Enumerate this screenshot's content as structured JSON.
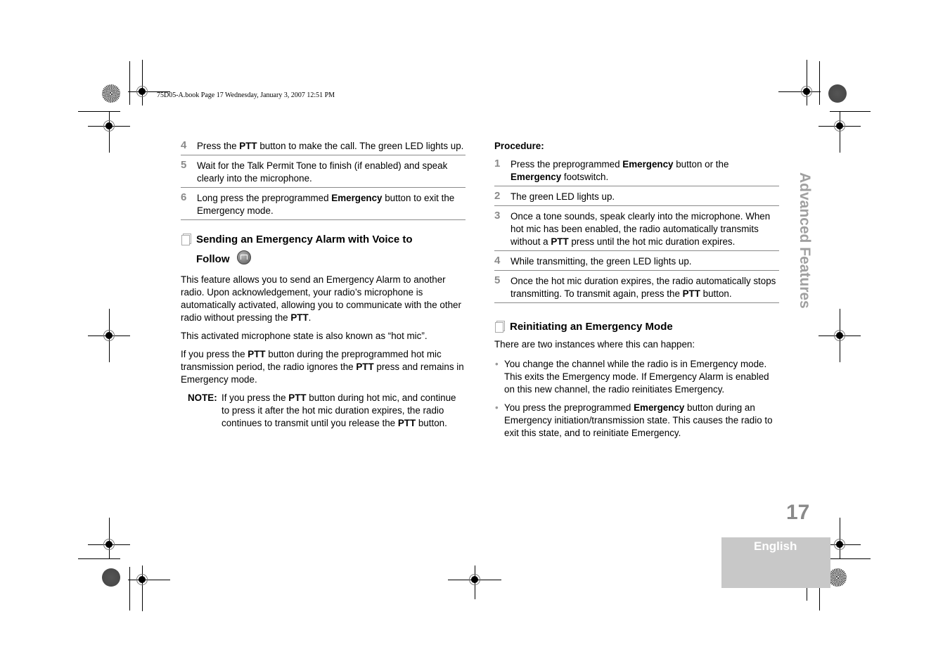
{
  "print_header": "75D05-A.book  Page 17  Wednesday, January 3, 2007  12:51 PM",
  "left_column": {
    "steps": [
      {
        "num": "4",
        "parts": [
          [
            "Press the ",
            false
          ],
          [
            "PTT",
            true
          ],
          [
            " button to make the call. The green LED lights up.",
            false
          ]
        ]
      },
      {
        "num": "5",
        "parts": [
          [
            "Wait for the Talk Permit Tone to finish (if enabled) and speak clearly into the microphone.",
            false
          ]
        ]
      },
      {
        "num": "6",
        "parts": [
          [
            "Long press the preprogrammed ",
            false
          ],
          [
            "Emergency",
            true
          ],
          [
            " button to exit the Emergency mode.",
            false
          ]
        ]
      }
    ],
    "section": {
      "title_line1": "Sending an Emergency Alarm with Voice to",
      "title_line2": "Follow",
      "icon": "page-icon",
      "feature_icon": "emergency-voice-feature-icon"
    },
    "paragraphs": [
      [
        [
          "This feature allows you to send an Emergency Alarm to another radio. Upon acknowledgement, your radio’s microphone is automatically activated, allowing you to communicate with the other radio without pressing the ",
          false
        ],
        [
          "PTT",
          true
        ],
        [
          ".",
          false
        ]
      ],
      [
        [
          "This activated microphone state is also known as “hot mic”.",
          false
        ]
      ],
      [
        [
          "If you press the ",
          false
        ],
        [
          "PTT",
          true
        ],
        [
          " button during the preprogrammed hot mic transmission period, the radio ignores the ",
          false
        ],
        [
          "PTT",
          true
        ],
        [
          " press and remains in Emergency mode.",
          false
        ]
      ]
    ],
    "note": {
      "label": "NOTE:",
      "parts": [
        [
          "If you press the ",
          false
        ],
        [
          "PTT",
          true
        ],
        [
          " button during hot mic, and continue to press it after the hot mic duration expires, the radio continues to transmit until you release the ",
          false
        ],
        [
          "PTT",
          true
        ],
        [
          " button.",
          false
        ]
      ]
    }
  },
  "right_column": {
    "procedure_label": "Procedure:",
    "steps": [
      {
        "num": "1",
        "parts": [
          [
            "Press the preprogrammed ",
            false
          ],
          [
            "Emergency",
            true
          ],
          [
            " button or the ",
            false
          ],
          [
            "Emergency",
            true
          ],
          [
            " footswitch.",
            false
          ]
        ]
      },
      {
        "num": "2",
        "parts": [
          [
            "The green LED lights up.",
            false
          ]
        ]
      },
      {
        "num": "3",
        "parts": [
          [
            "Once a tone sounds, speak clearly into the microphone. When hot mic has been enabled, the radio automatically transmits without a ",
            false
          ],
          [
            "PTT",
            true
          ],
          [
            " press until the hot mic duration expires.",
            false
          ]
        ]
      },
      {
        "num": "4",
        "parts": [
          [
            "While transmitting, the green LED lights up.",
            false
          ]
        ]
      },
      {
        "num": "5",
        "parts": [
          [
            "Once the hot mic duration expires, the radio automatically stops transmitting. To transmit again, press the ",
            false
          ],
          [
            "PTT",
            true
          ],
          [
            " button.",
            false
          ]
        ]
      }
    ],
    "section": {
      "title": "Reinitiating an Emergency Mode",
      "icon": "page-icon"
    },
    "intro": "There are two instances where this can happen:",
    "bullets": [
      [
        [
          "You change the channel while the radio is in Emergency mode. This exits the Emergency mode. If Emergency Alarm is enabled on this new channel, the radio reinitiates Emergency.",
          false
        ]
      ],
      [
        [
          "You press the preprogrammed ",
          false
        ],
        [
          "Emergency",
          true
        ],
        [
          " button during an Emergency initiation/transmission state. This causes the radio to exit this state, and to reinitiate Emergency.",
          false
        ]
      ]
    ]
  },
  "side_tab": "Advanced Features",
  "page_number": "17",
  "language_tab": "English",
  "colors": {
    "step_number": "#8a8a8a",
    "side_tab": "#a0a0a0",
    "language_box": "#c8c8c8"
  }
}
